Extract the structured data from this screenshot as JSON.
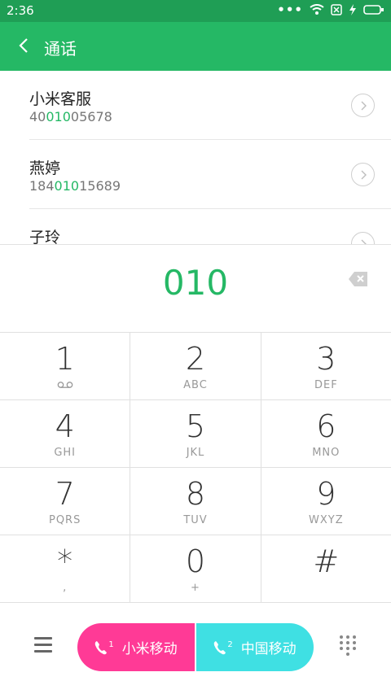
{
  "status_bar": {
    "time": "2:36",
    "dots": "•••"
  },
  "header": {
    "title": "通话"
  },
  "contacts": [
    {
      "name": "小米客服",
      "number_pre": "40",
      "number_hl": "010",
      "number_post": "05678"
    },
    {
      "name": "燕婷",
      "number_pre": "184",
      "number_hl": "010",
      "number_post": "15689"
    },
    {
      "name": "子玲",
      "number_pre": "",
      "number_hl": "",
      "number_post": ""
    }
  ],
  "dialed": "010",
  "keypad": [
    {
      "digit": "1",
      "letters": ""
    },
    {
      "digit": "2",
      "letters": "ABC"
    },
    {
      "digit": "3",
      "letters": "DEF"
    },
    {
      "digit": "4",
      "letters": "GHI"
    },
    {
      "digit": "5",
      "letters": "JKL"
    },
    {
      "digit": "6",
      "letters": "MNO"
    },
    {
      "digit": "7",
      "letters": "PQRS"
    },
    {
      "digit": "8",
      "letters": "TUV"
    },
    {
      "digit": "9",
      "letters": "WXYZ"
    },
    {
      "digit": "*",
      "letters": ","
    },
    {
      "digit": "0",
      "letters": "+"
    },
    {
      "digit": "#",
      "letters": ""
    }
  ],
  "sim1": {
    "label": "小米移动",
    "slot": "1",
    "color": "#ff3a96"
  },
  "sim2": {
    "label": "中国移动",
    "slot": "2",
    "color": "#3fe0e3"
  },
  "colors": {
    "accent": "#25b865",
    "status_bar": "#1f9e55"
  }
}
